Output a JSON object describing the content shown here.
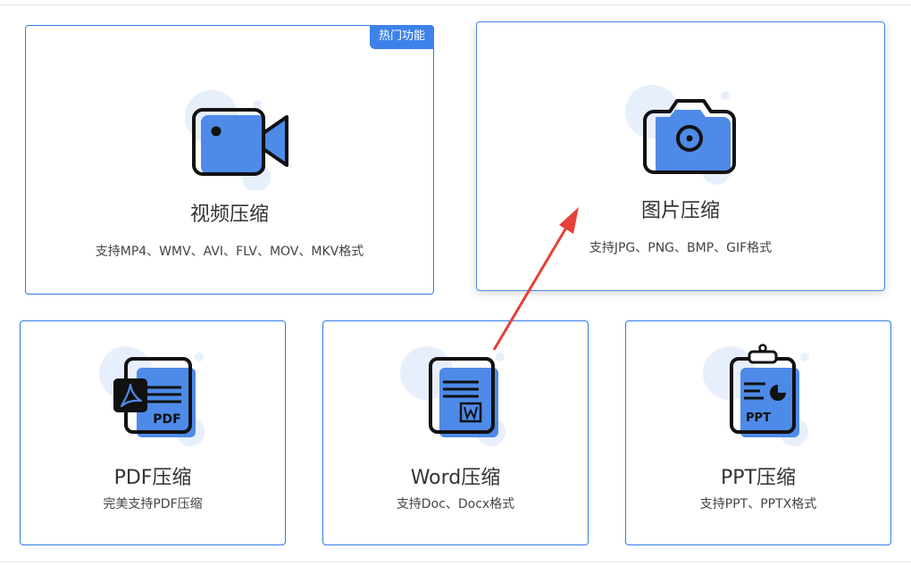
{
  "cards": {
    "video": {
      "title": "视频压缩",
      "desc": "支持MP4、WMV、AVI、FLV、MOV、MKV格式",
      "badge": "热门功能",
      "icon": "video-camera-icon"
    },
    "image": {
      "title": "图片压缩",
      "desc": "支持JPG、PNG、BMP、GIF格式",
      "icon": "camera-icon"
    },
    "pdf": {
      "title": "PDF压缩",
      "desc": "完美支持PDF压缩",
      "icon": "pdf-document-icon",
      "icon_text": "PDF"
    },
    "word": {
      "title": "Word压缩",
      "desc": "支持Doc、Docx格式",
      "icon": "word-document-icon"
    },
    "ppt": {
      "title": "PPT压缩",
      "desc": "支持PPT、PPTX格式",
      "icon": "ppt-clipboard-icon",
      "icon_text": "PPT"
    }
  },
  "colors": {
    "accent": "#3d82ea",
    "icon_fill": "#4e8ae8",
    "icon_bg_light": "#e8effc",
    "border": "#2f7be0",
    "annotation_arrow": "#e8403a"
  }
}
